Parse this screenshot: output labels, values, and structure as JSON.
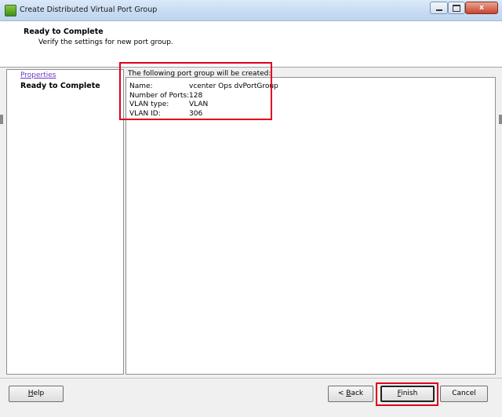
{
  "window": {
    "title": "Create Distributed Virtual Port Group",
    "controls": {
      "minimize": "",
      "maximize": "",
      "close": "x"
    }
  },
  "header": {
    "title": "Ready to Complete",
    "subtitle": "Verify the settings for new port group."
  },
  "steps": {
    "items": [
      {
        "label": "Properties",
        "state": "link"
      },
      {
        "label": "Ready to Complete",
        "state": "current"
      }
    ]
  },
  "main": {
    "label": "The following port group will be created:",
    "summary": [
      {
        "key": "Name:",
        "value": "vcenter Ops dvPortGroup"
      },
      {
        "key": "Number of Ports:",
        "value": "128"
      },
      {
        "key": "VLAN type:",
        "value": "VLAN"
      },
      {
        "key": "VLAN ID:",
        "value": "306"
      }
    ]
  },
  "footer": {
    "help": {
      "mnemonic": "H",
      "rest": "elp"
    },
    "back": {
      "prefix": "< ",
      "mnemonic": "B",
      "rest": "ack"
    },
    "finish": {
      "mnemonic": "F",
      "rest": "inish"
    },
    "cancel": "Cancel"
  },
  "colors": {
    "highlight": "#e0001b",
    "link": "#6a3ac4",
    "titlebar": "#c6dbf2",
    "panel_bg": "#f0f0f0"
  }
}
